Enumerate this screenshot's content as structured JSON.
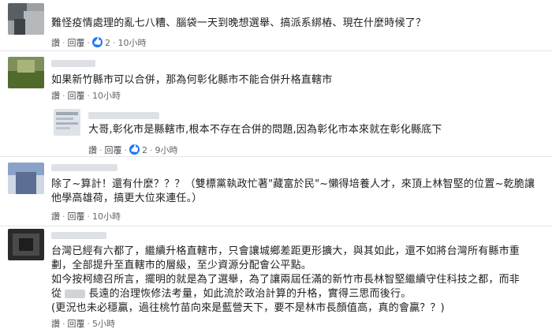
{
  "comments": [
    {
      "text": "難怪疫情處理的亂七八糟、腦袋一天到晚想選舉、搞派系綁樁、現在什麼時候了？",
      "actions": {
        "like": "讚",
        "reply": "回覆"
      },
      "likes": "2",
      "time": "10小時"
    },
    {
      "text": "如果新竹縣市可以合併，那為何彰化縣市不能合併升格直轄市",
      "actions": {
        "like": "讚",
        "reply": "回覆"
      },
      "time": "10小時"
    },
    {
      "text": "大哥,彰化市是縣轄市,根本不存在合併的問題,因為彰化市本來就在彰化縣底下",
      "actions": {
        "like": "讚",
        "reply": "回覆"
      },
      "likes": "2",
      "time": "9小時"
    },
    {
      "lines": [
        "除了~算計！還有什麼？？？（雙標黨執政忙著\"藏富於民\"~懶得培養人才，來頂上林智堅的位置~乾脆讓",
        "他學高雄荷，搞更大位來連任。）"
      ],
      "actions": {
        "like": "讚",
        "reply": "回覆"
      },
      "time": "10小時"
    },
    {
      "lines": [
        "台灣已經有六都了，繼續升格直轄市，只會讓城鄉差距更形擴大，與其如此，還不如將台灣所有縣市重",
        "劃，全部提升至直轄市的層級，至少資源分配會公平點。",
        "如今按柯總召所言，擺明的就是為了選舉，為了讓兩屆任滿的新竹市長林智堅繼續守住科技之都，而非",
        "從",
        "長遠的治理恢修法考量，如此流於政治計算的升格，實得三思而後行。",
        "(更況也未必穩贏，過往桃竹苗向來是藍營天下，要不是林市長顏值高，真的會贏？？)"
      ],
      "actions": {
        "like": "讚",
        "reply": "回覆"
      },
      "time": "5小時"
    }
  ]
}
